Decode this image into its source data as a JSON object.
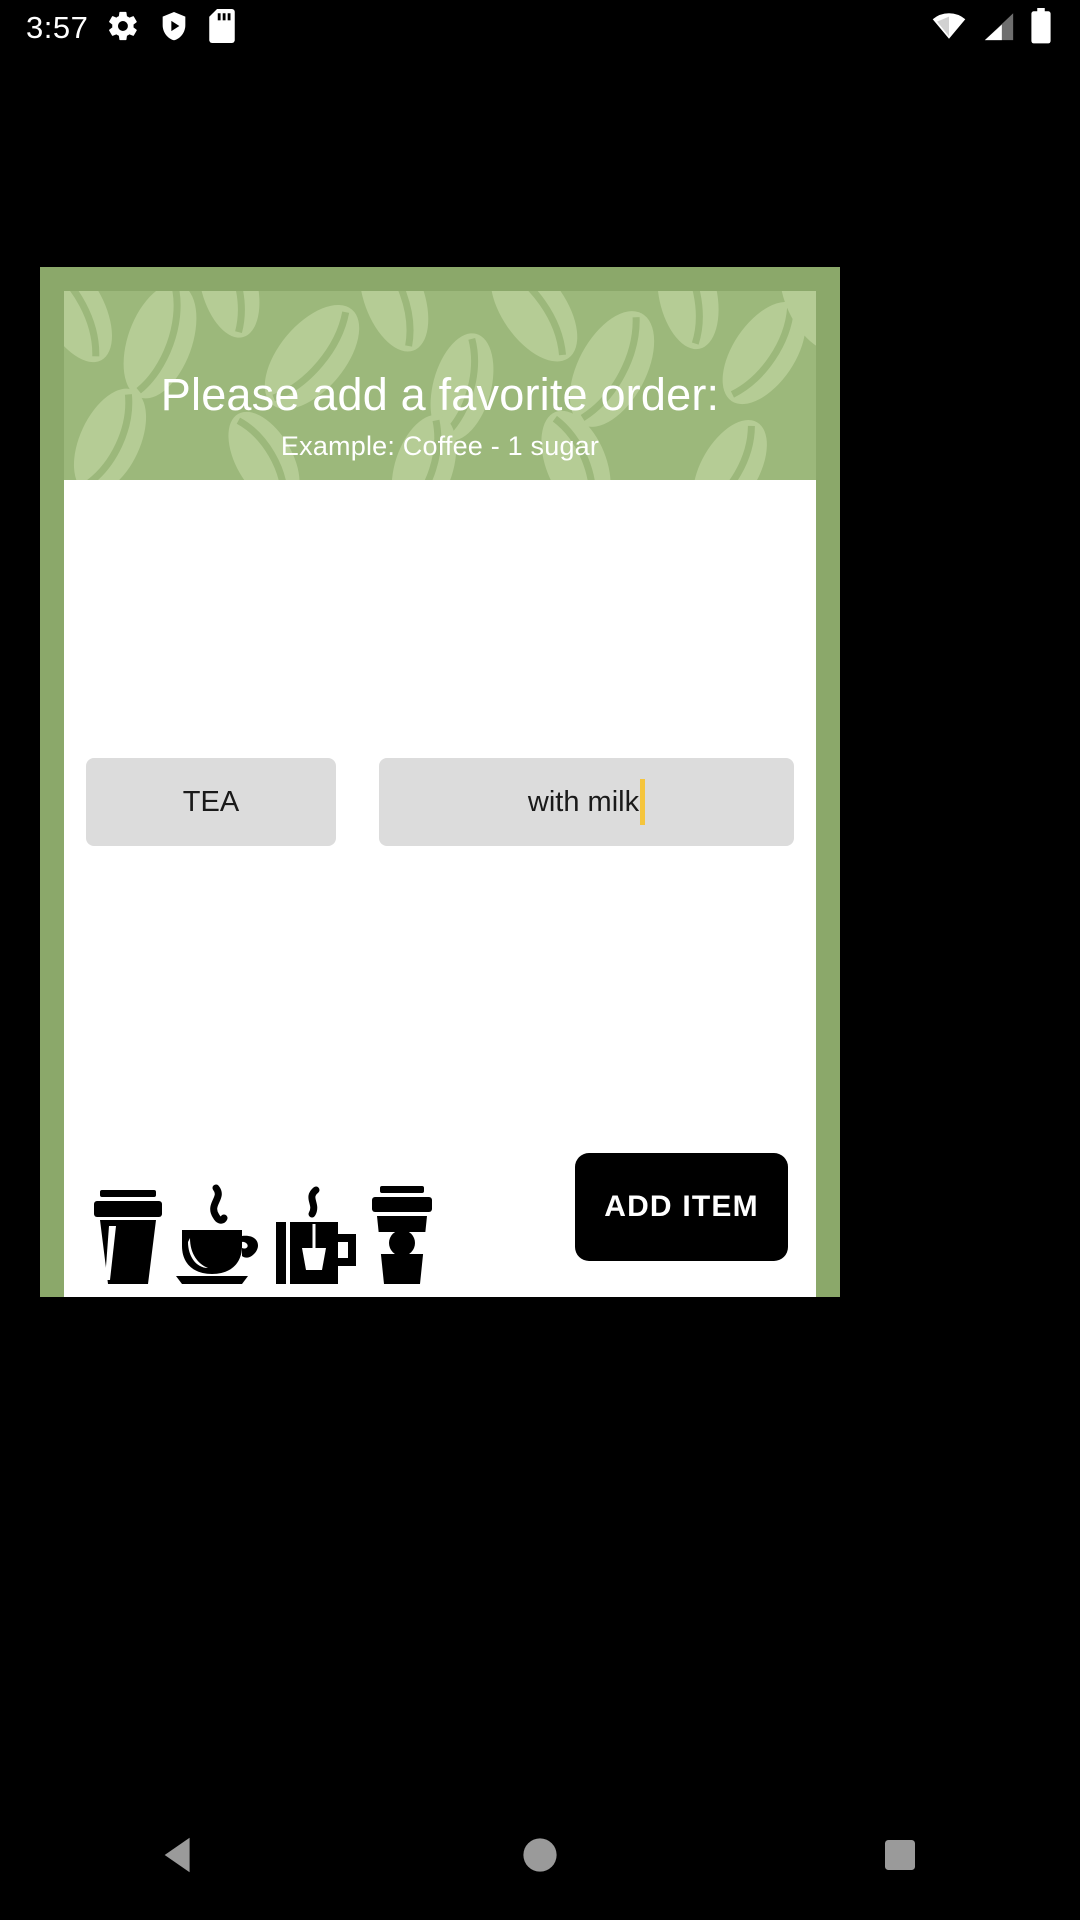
{
  "status_bar": {
    "time": "3:57",
    "left_icons": [
      "gear-icon",
      "play-protect-shield-icon",
      "sd-card-icon"
    ],
    "right_icons": [
      "wifi-icon",
      "cellular-signal-icon",
      "battery-icon"
    ]
  },
  "dialog": {
    "title": "Please add a favorite order:",
    "subtitle": "Example: Coffee - 1 sugar",
    "header_color": "#9cb87b",
    "frame_color": "#8ba86a",
    "fields": [
      {
        "name": "order-name-field",
        "value": "TEA",
        "placeholder": "",
        "focused": false
      },
      {
        "name": "order-notes-field",
        "value": "with milk",
        "placeholder": "",
        "focused": true
      }
    ],
    "field_background": "#dcdcdc",
    "caret_color": "#f5c53d",
    "drink_icons": [
      "cold-cup-icon",
      "coffee-cup-saucer-icon",
      "tea-mug-icon",
      "takeaway-coffee-cup-icon"
    ],
    "add_button": {
      "label": "ADD ITEM",
      "background": "#000000",
      "text_color": "#ffffff"
    }
  },
  "nav_bar": {
    "back_label": "back-button",
    "home_label": "home-button",
    "recents_label": "recents-button"
  }
}
